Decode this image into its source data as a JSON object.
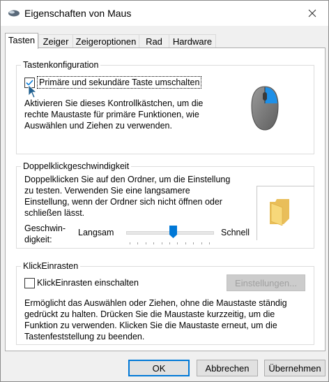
{
  "window": {
    "title": "Eigenschaften von Maus"
  },
  "tabs": [
    {
      "label": "Tasten"
    },
    {
      "label": "Zeiger"
    },
    {
      "label": "Zeigeroptionen"
    },
    {
      "label": "Rad"
    },
    {
      "label": "Hardware"
    }
  ],
  "button_config": {
    "legend": "Tastenkonfiguration",
    "checkbox_label": "Primäre und sekundäre Taste umschalten",
    "checked": true,
    "description": [
      "Aktivieren Sie dieses Kontrollkästchen, um die",
      "rechte Maustaste für primäre Funktionen, wie",
      "Auswählen und Ziehen zu verwenden."
    ]
  },
  "double_click": {
    "legend": "Doppelklickgeschwindigkeit",
    "description": [
      "Doppelklicken Sie auf den Ordner, um die Einstellung",
      "zu testen. Verwenden Sie eine langsamere",
      "Einstellung, wenn der Ordner sich nicht öffnen oder",
      "schließen lässt."
    ],
    "speed_label_line1": "Geschwin-",
    "speed_label_line2": "digkeit:",
    "slow_label": "Langsam",
    "fast_label": "Schnell",
    "slider_level": 0.55
  },
  "click_lock": {
    "legend": "KlickEinrasten",
    "checkbox_label": "KlickEinrasten einschalten",
    "checked": false,
    "settings_button": "Einstellungen...",
    "description": [
      "Ermöglicht das Auswählen oder Ziehen, ohne die Maustaste ständig",
      "gedrückt zu halten. Drücken Sie die Maustaste kurzzeitig, um die",
      "Funktion zu verwenden. Klicken Sie die Maustaste erneut, um die",
      "Tastenfeststellung zu beenden."
    ]
  },
  "footer": {
    "ok": "OK",
    "cancel": "Abbrechen",
    "apply": "Übernehmen"
  },
  "colors": {
    "accent": "#0078d7",
    "folder": "#f4d274",
    "mouse_body": "#7a7a7a",
    "mouse_button": "#1e90e8"
  }
}
